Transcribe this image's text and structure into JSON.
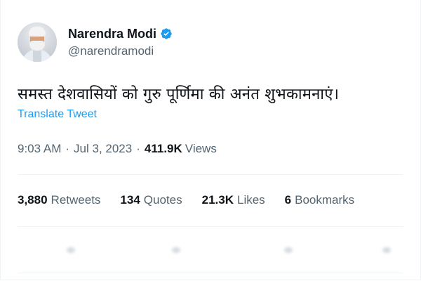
{
  "tweet": {
    "author": {
      "display_name": "Narendra Modi",
      "handle": "@narendramodi",
      "verified": true,
      "verified_color": "#1d9bf0"
    },
    "text": "समस्त देशवासियों को गुरु पूर्णिमा की अनंत शुभकामनाएं।",
    "translate_label": "Translate Tweet",
    "meta": {
      "time": "9:03 AM",
      "separator": "·",
      "date": "Jul 3, 2023",
      "views_count": "411.9K",
      "views_label": "Views"
    },
    "stats": [
      {
        "count": "3,880",
        "label": "Retweets"
      },
      {
        "count": "134",
        "label": "Quotes"
      },
      {
        "count": "21.3K",
        "label": "Likes"
      },
      {
        "count": "6",
        "label": "Bookmarks"
      }
    ],
    "actions": [
      {
        "icon": "reply-icon"
      },
      {
        "icon": "retweet-icon"
      },
      {
        "icon": "like-icon"
      },
      {
        "icon": "bookmark-icon"
      }
    ]
  },
  "colors": {
    "text_primary": "#0f1419",
    "text_secondary": "#536471",
    "link": "#1d9bf0",
    "divider": "#eff3f4"
  }
}
